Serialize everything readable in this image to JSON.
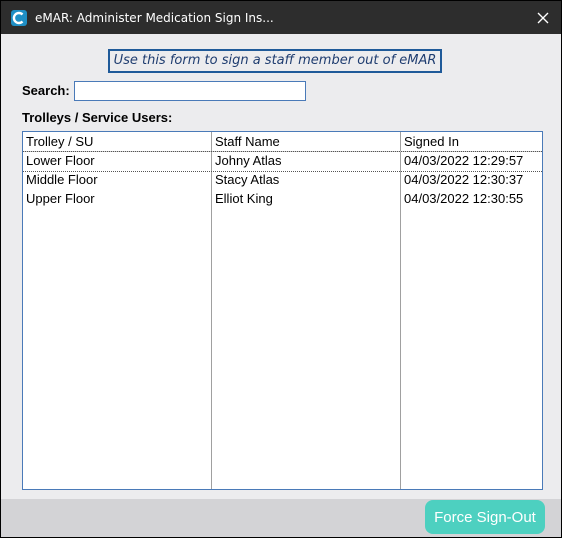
{
  "window": {
    "title": "eMAR: Administer Medication Sign Ins...",
    "app_icon": "emar-logo-icon",
    "close_icon": "close-icon"
  },
  "banner": {
    "text": "Use this form to sign a staff member out of eMAR"
  },
  "search": {
    "label": "Search:",
    "value": "",
    "placeholder": ""
  },
  "list_section": {
    "label": "Trolleys / Service Users:",
    "columns": [
      "Trolley / SU",
      "Staff Name",
      "Signed In"
    ],
    "rows": [
      {
        "trolley": "Lower Floor",
        "staff": "Johny Atlas",
        "signed_in": "04/03/2022 12:29:57"
      },
      {
        "trolley": "Middle Floor",
        "staff": "Stacy Atlas",
        "signed_in": "04/03/2022 12:30:37"
      },
      {
        "trolley": "Upper Floor",
        "staff": "Elliot King",
        "signed_in": "04/03/2022 12:30:55"
      }
    ]
  },
  "footer": {
    "force_signout_label": "Force Sign-Out"
  },
  "colors": {
    "titlebar": "#2d2d2d",
    "accent_border": "#1f5a99",
    "button": "#4dd0c0"
  }
}
